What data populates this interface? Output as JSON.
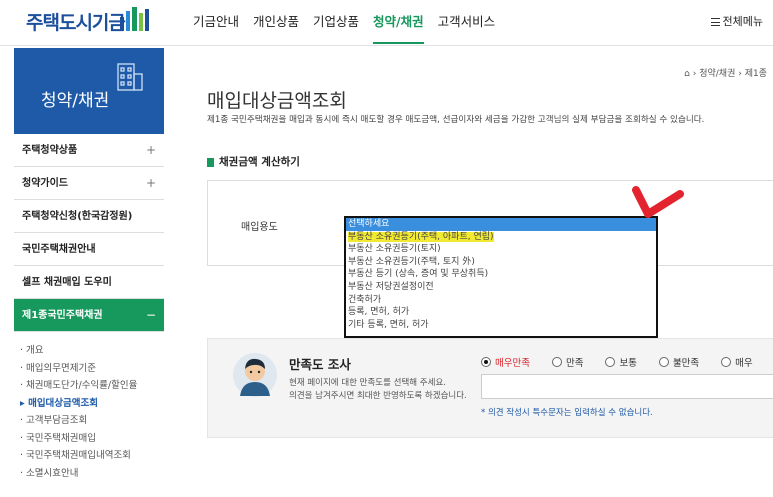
{
  "header": {
    "logo": "주택도시기금",
    "gnb": [
      "기금안내",
      "개인상품",
      "기업상품",
      "청약/채권",
      "고객서비스"
    ],
    "active_gnb": 3,
    "all_menu": "전체메뉴"
  },
  "sidebar": {
    "title": "청약/채권",
    "items": [
      {
        "label": "주택청약상품",
        "toggle": "+"
      },
      {
        "label": "청약가이드",
        "toggle": "+"
      },
      {
        "label": "주택청약신청(한국감정원)",
        "toggle": ""
      },
      {
        "label": "국민주택채권안내",
        "toggle": ""
      },
      {
        "label": "셀프 채권매입 도우미",
        "toggle": ""
      },
      {
        "label": "제1종국민주택채권",
        "toggle": "−"
      }
    ],
    "sub_items": [
      "개요",
      "매입의무면제기준",
      "채권매도단가/수익률/할인율",
      "매입대상금액조회",
      "고객부담금조회",
      "국민주택채권매입",
      "국민주택채권매입내역조회",
      "소멸시효안내"
    ],
    "sub_active": 3
  },
  "breadcrumb": {
    "items": [
      "청약/채권",
      "제1종"
    ]
  },
  "page": {
    "title": "매입대상금액조회",
    "description": "제1종 국민주택채권을 매입과 동시에 즉시 매도할 경우 매도금액, 선급이자와 세금을 가감한 고객님의 실제 부담금을 조회하실 수 있습니다.",
    "section_title": "채권금액 계산하기"
  },
  "form": {
    "label": "매입용도",
    "options": [
      "선택하세요",
      "부동산 소유권등기(주택, 아파트, 연립)",
      "부동산 소유권등기(토지)",
      "부동산 소유권등기(주택, 토지 外)",
      "부동산 등기 (상속, 증여 및 무상취득)",
      "부동산 저당권설정이전",
      "건축허가",
      "등록, 면허, 허가",
      "기타 등록, 면허, 허가"
    ],
    "selected_index": 0,
    "highlighted_index": 1
  },
  "survey": {
    "title": "만족도 조사",
    "desc_line1": "현재 페이지에 대한 만족도를 선택해 주세요.",
    "desc_line2": "의견을 남겨주시면 최대한 반영하도록 하겠습니다.",
    "options": [
      "매우만족",
      "만족",
      "보통",
      "불만족",
      "매우"
    ],
    "selected_index": 0,
    "note": "* 의견 작성시 특수문자는 입력하실 수 없습니다."
  },
  "colors": {
    "brand_blue": "#1e5aa8",
    "green": "#17985d",
    "annotation_red": "#e3232e"
  }
}
